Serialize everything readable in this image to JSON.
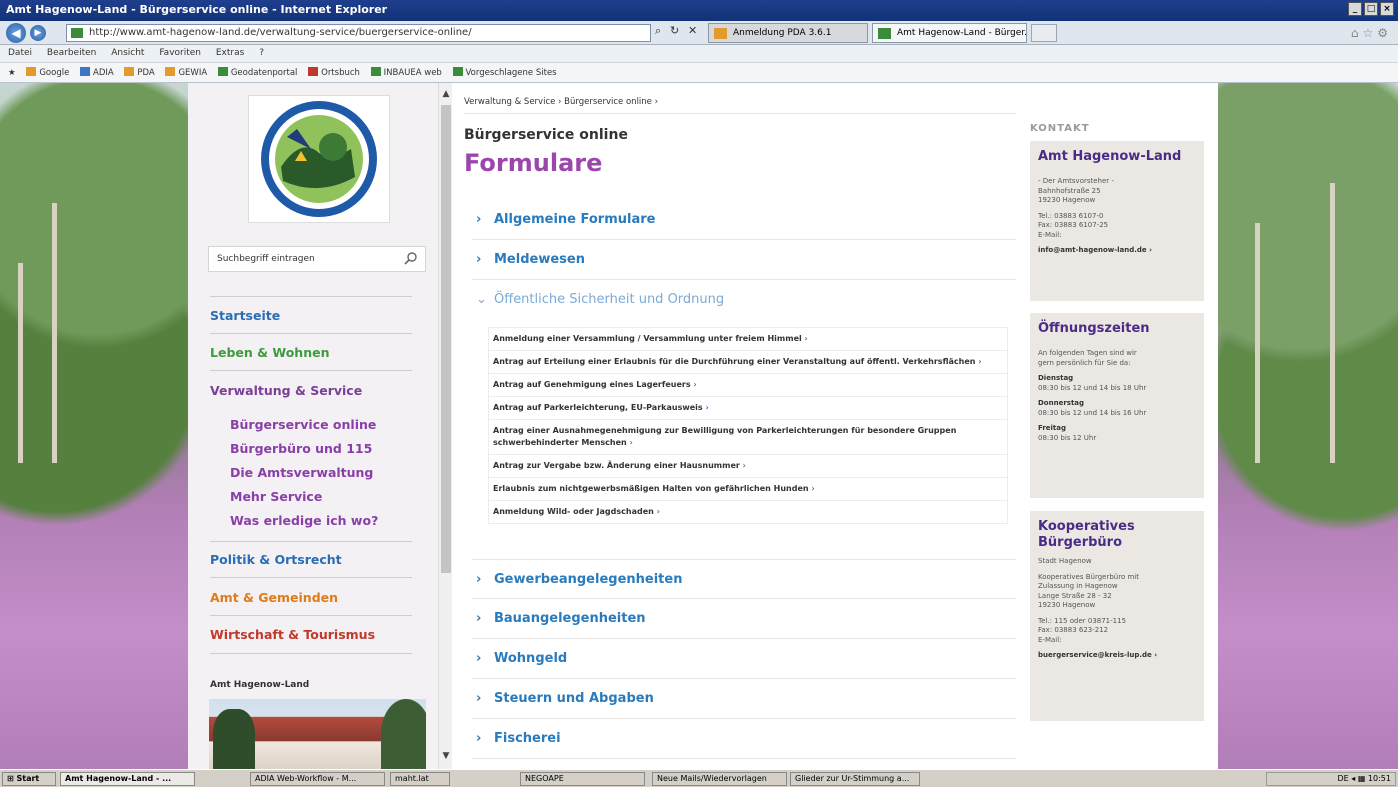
{
  "browser": {
    "title": "Amt Hagenow-Land - Bürgerservice online - Internet Explorer",
    "address": "http://www.amt-hagenow-land.de/verwaltung-service/buergerservice-online/",
    "tabs": [
      {
        "label": "Anmeldung PDA 3.6.1"
      },
      {
        "label": "Amt Hagenow-Land - Bürger..."
      }
    ],
    "menu": [
      "Datei",
      "Bearbeiten",
      "Ansicht",
      "Favoriten",
      "Extras",
      "?"
    ],
    "favorites": [
      "Google",
      "ADIA",
      "PDA",
      "GEWIA",
      "Geodatenportal",
      "Ortsbuch",
      "INBAUEA web",
      "Vorgeschlagene Sites"
    ]
  },
  "sidebar": {
    "search_placeholder": "Suchbegriff eintragen",
    "nav": [
      {
        "label": "Startseite",
        "color": "#2a6db5"
      },
      {
        "label": "Leben & Wohnen",
        "color": "#3e9a3e"
      },
      {
        "label": "Verwaltung & Service",
        "color": "#7a3f98"
      }
    ],
    "subnav": [
      {
        "label": "Bürgerservice online"
      },
      {
        "label": "Bürgerbüro und 115"
      },
      {
        "label": "Die Amtsverwaltung"
      },
      {
        "label": "Mehr Service"
      },
      {
        "label": "Was erledige ich wo?"
      }
    ],
    "nav_bottom": [
      {
        "label": "Politik & Ortsrecht",
        "color": "#2a6db5"
      },
      {
        "label": "Amt & Gemeinden",
        "color": "#e07b1a"
      },
      {
        "label": "Wirtschaft & Tourismus",
        "color": "#c0392b"
      }
    ],
    "bottom_label": "Amt Hagenow-Land"
  },
  "main": {
    "breadcrumb": "Verwaltung & Service › Bürgerservice online ›",
    "subtitle": "Bürgerservice online",
    "title": "Formulare",
    "accordion_top": [
      {
        "label": "Allgemeine Formulare"
      },
      {
        "label": "Meldewesen"
      }
    ],
    "accordion_open": {
      "label": "Öffentliche Sicherheit und Ordnung"
    },
    "forms": [
      {
        "text": "Anmeldung einer Versammlung / Versammlung unter freiem Himmel"
      },
      {
        "text": "Antrag auf Erteilung einer Erlaubnis für die Durchführung einer Veranstaltung auf öffentl. Verkehrsflächen"
      },
      {
        "text": "Antrag auf Genehmigung eines Lagerfeuers"
      },
      {
        "text": "Antrag auf Parkerleichterung, EU-Parkausweis"
      },
      {
        "text": "Antrag einer Ausnahmegenehmigung zur Bewilligung von Parkerleichterungen für besondere Gruppen schwerbehinderter Menschen"
      },
      {
        "text": "Antrag zur Vergabe bzw. Änderung einer Hausnummer"
      },
      {
        "text": "Erlaubnis zum nichtgewerbsmäßigen Halten von gefährlichen Hunden"
      },
      {
        "text": "Anmeldung Wild- oder Jagdschaden"
      }
    ],
    "accordion_bottom": [
      {
        "label": "Gewerbeangelegenheiten"
      },
      {
        "label": "Bauangelegenheiten"
      },
      {
        "label": "Wohngeld"
      },
      {
        "label": "Steuern und Abgaben"
      },
      {
        "label": "Fischerei"
      }
    ]
  },
  "right": {
    "kontakt_label": "KONTAKT",
    "contact": {
      "title": "Amt Hagenow-Land",
      "lines": [
        "- Der Amtsvorsteher -",
        "Bahnhofstraße 25",
        "19230 Hagenow"
      ],
      "phone": [
        "Tel.: 03883 6107-0",
        "Fax: 03883 6107-25",
        "E-Mail:"
      ],
      "email": "info@amt-hagenow-land.de ›"
    },
    "hours": {
      "title": "Öffnungszeiten",
      "intro": [
        "An folgenden Tagen sind wir",
        "gern persönlich für Sie da:"
      ],
      "days": [
        {
          "day": "Dienstag",
          "time": "08:30 bis 12 und 14 bis 18 Uhr"
        },
        {
          "day": "Donnerstag",
          "time": "08:30 bis 12 und 14 bis 16 Uhr"
        },
        {
          "day": "Freitag",
          "time": "08:30 bis 12 Uhr"
        }
      ]
    },
    "office": {
      "title": "Kooperatives Bürgerbüro",
      "city": "Stadt Hagenow",
      "lines": [
        "Kooperatives Bürgerbüro mit",
        "Zulassung in Hagenow",
        "Lange Straße 28 - 32",
        "19230 Hagenow"
      ],
      "phone": [
        "Tel.: 115 oder 03871-115",
        "Fax: 03883 623-212",
        "E-Mail:"
      ],
      "email": "buergerservice@kreis-lup.de ›"
    }
  },
  "taskbar": {
    "start": "Start",
    "items": [
      {
        "label": "Amt Hagenow-Land - ..."
      },
      {
        "label": "ADIA Web-Workflow - M..."
      },
      {
        "label": "maht.lat"
      },
      {
        "label": "NEGOAPE"
      },
      {
        "label": "Neue Mails/Wiedervorlagen"
      },
      {
        "label": "Glieder zur Ur-Stimmung a..."
      }
    ],
    "tray": "DE  ◂  ▦  10:51"
  },
  "colors": {
    "accent_purple": "#9b46ad",
    "link_blue": "#2a7bbd",
    "box_title": "#4a2c86"
  }
}
